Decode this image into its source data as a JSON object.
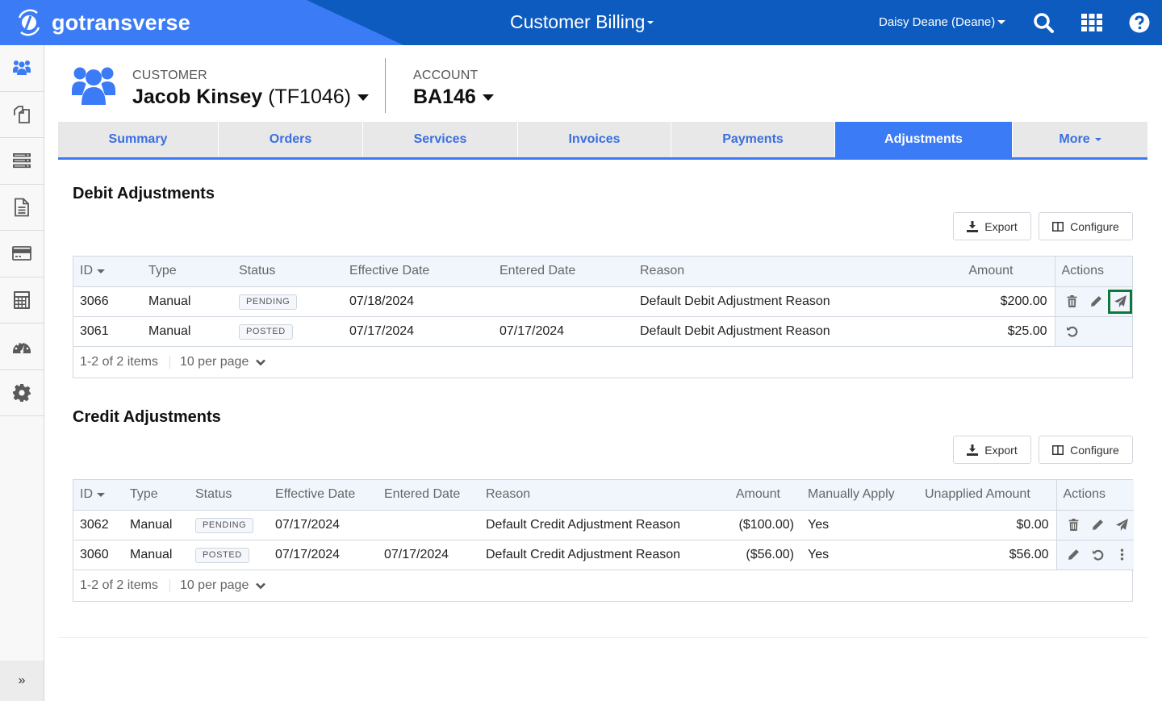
{
  "header": {
    "brand": "gotransverse",
    "app_title": "Customer Billing",
    "user": "Daisy Deane (Deane)",
    "icons": [
      "search-icon",
      "apps-grid-icon",
      "help-icon"
    ]
  },
  "sidebar": {
    "items": [
      {
        "name": "customers",
        "icon": "users-icon",
        "active": true
      },
      {
        "name": "documents",
        "icon": "copy-icon",
        "active": false
      },
      {
        "name": "services",
        "icon": "server-icon",
        "active": false
      },
      {
        "name": "invoices",
        "icon": "file-icon",
        "active": false
      },
      {
        "name": "payments",
        "icon": "credit-card-icon",
        "active": false
      },
      {
        "name": "calculator",
        "icon": "calculator-icon",
        "active": false
      },
      {
        "name": "dashboard",
        "icon": "gauge-icon",
        "active": false
      },
      {
        "name": "settings",
        "icon": "gear-icon",
        "active": false
      }
    ],
    "expand_label": "»"
  },
  "customer": {
    "label": "CUSTOMER",
    "name": "Jacob Kinsey",
    "code": "(TF1046)"
  },
  "account": {
    "label": "ACCOUNT",
    "value": "BA146"
  },
  "tabs": [
    {
      "label": "Summary",
      "active": false
    },
    {
      "label": "Orders",
      "active": false
    },
    {
      "label": "Services",
      "active": false
    },
    {
      "label": "Invoices",
      "active": false
    },
    {
      "label": "Payments",
      "active": false
    },
    {
      "label": "Adjustments",
      "active": true
    },
    {
      "label": "More",
      "active": false
    }
  ],
  "debit": {
    "title": "Debit Adjustments",
    "export_label": "Export",
    "configure_label": "Configure",
    "columns": [
      "ID",
      "Type",
      "Status",
      "Effective Date",
      "Entered Date",
      "Reason",
      "Amount",
      "Actions"
    ],
    "rows": [
      {
        "id": "3066",
        "type": "Manual",
        "status": "PENDING",
        "effective": "07/18/2024",
        "entered": "",
        "reason": "Default Debit Adjustment Reason",
        "amount": "$200.00",
        "actions": [
          "delete",
          "edit",
          "post"
        ]
      },
      {
        "id": "3061",
        "type": "Manual",
        "status": "POSTED",
        "effective": "07/17/2024",
        "entered": "07/17/2024",
        "reason": "Default Debit Adjustment Reason",
        "amount": "$25.00",
        "actions": [
          "reverse"
        ]
      }
    ],
    "pager": {
      "summary": "1-2 of 2 items",
      "per_page": "10 per page"
    }
  },
  "credit": {
    "title": "Credit Adjustments",
    "export_label": "Export",
    "configure_label": "Configure",
    "columns": [
      "ID",
      "Type",
      "Status",
      "Effective Date",
      "Entered Date",
      "Reason",
      "Amount",
      "Manually Apply",
      "Unapplied Amount",
      "Actions"
    ],
    "rows": [
      {
        "id": "3062",
        "type": "Manual",
        "status": "PENDING",
        "effective": "07/17/2024",
        "entered": "",
        "reason": "Default Credit Adjustment Reason",
        "amount": "($100.00)",
        "manual": "Yes",
        "unapplied": "$0.00",
        "actions": [
          "delete",
          "edit",
          "post"
        ]
      },
      {
        "id": "3060",
        "type": "Manual",
        "status": "POSTED",
        "effective": "07/17/2024",
        "entered": "07/17/2024",
        "reason": "Default Credit Adjustment Reason",
        "amount": "($56.00)",
        "manual": "Yes",
        "unapplied": "$56.00",
        "actions": [
          "edit",
          "reverse",
          "more"
        ]
      }
    ],
    "pager": {
      "summary": "1-2 of 2 items",
      "per_page": "10 per page"
    }
  },
  "colors": {
    "brand_blue": "#3b7bf6",
    "header_dark": "#0d5bbf",
    "highlight_green": "#0e7a3a"
  }
}
